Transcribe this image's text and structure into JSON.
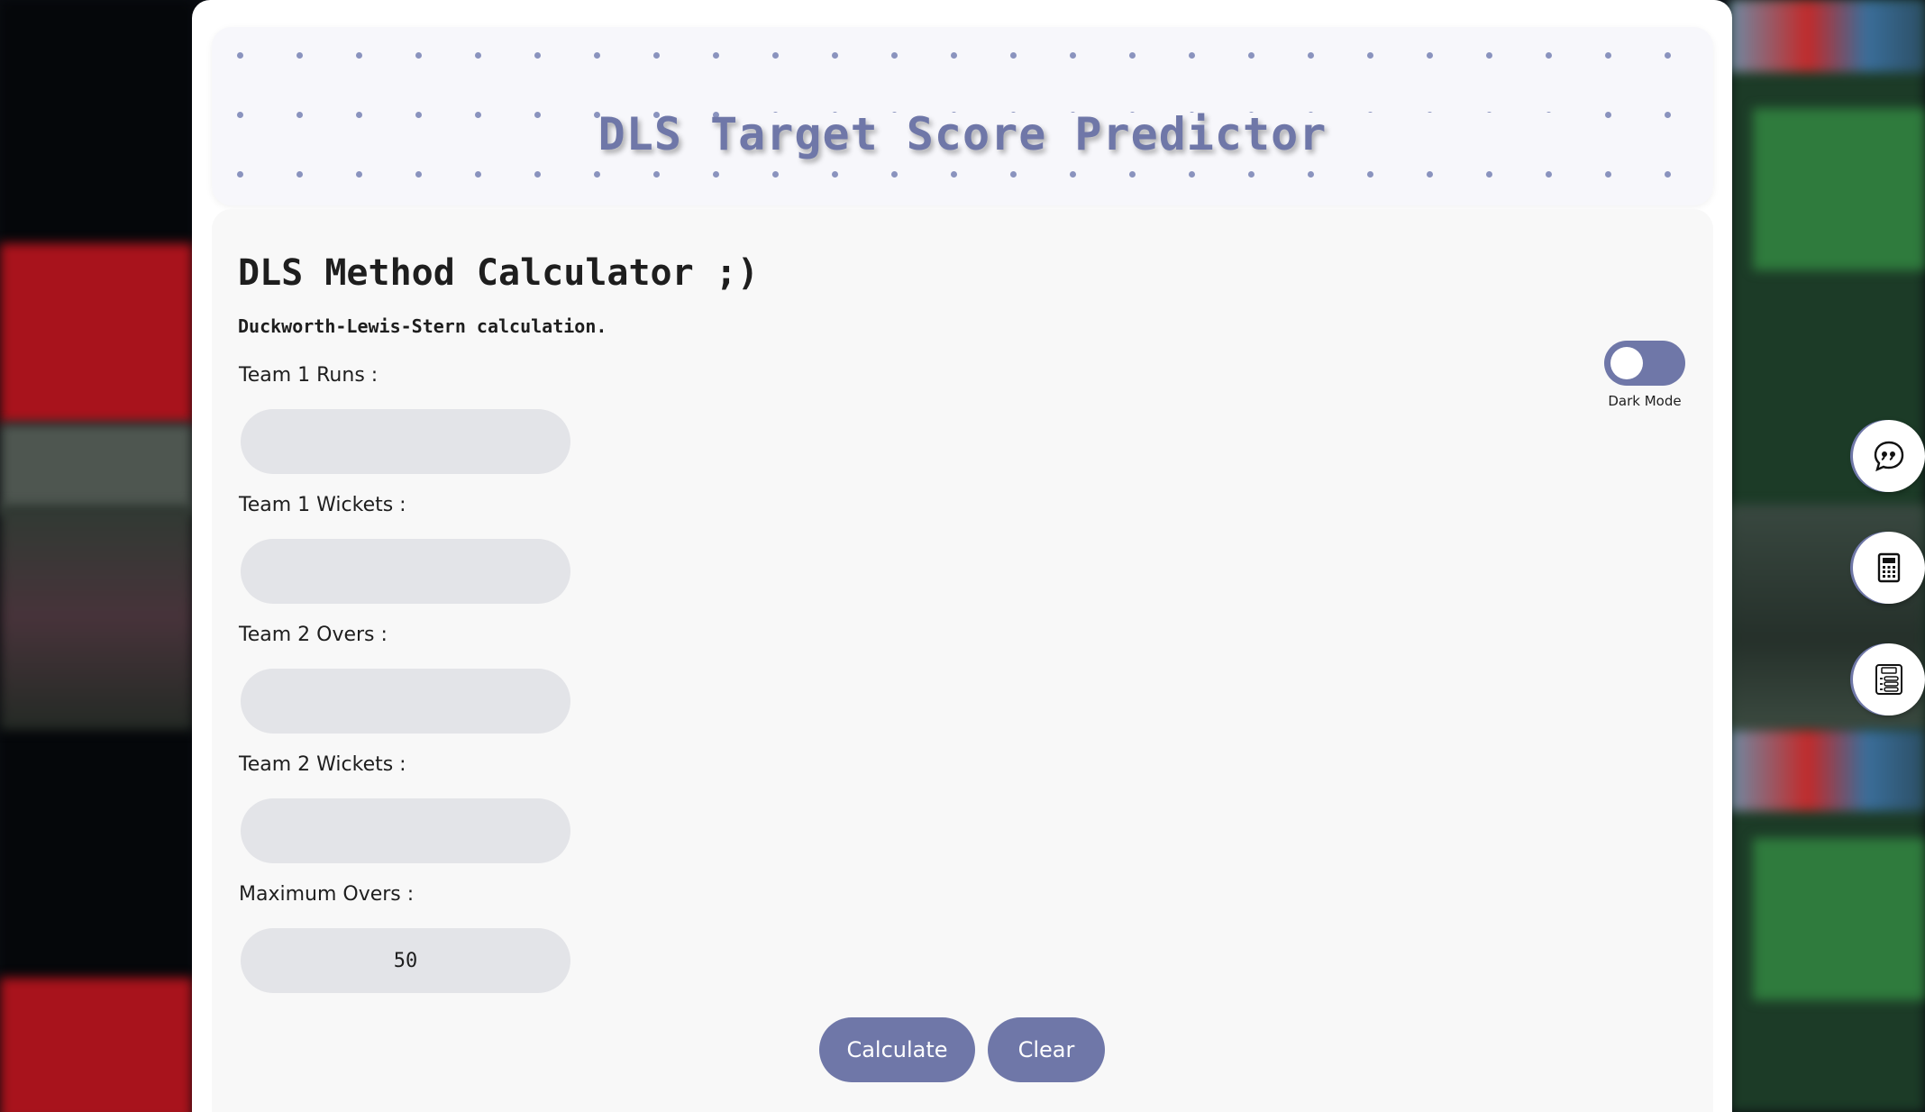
{
  "header": {
    "title": "DLS Target Score Predictor"
  },
  "calculator": {
    "title": "DLS Method Calculator ;)",
    "subtitle": "Duckworth-Lewis-Stern calculation.",
    "fields": [
      {
        "label": "Team 1 Runs :",
        "value": ""
      },
      {
        "label": "Team 1 Wickets :",
        "value": ""
      },
      {
        "label": "Team 2 Overs :",
        "value": ""
      },
      {
        "label": "Team 2 Wickets :",
        "value": ""
      },
      {
        "label": "Maximum Overs :",
        "value": "50"
      }
    ],
    "calculate_label": "Calculate",
    "clear_label": "Clear"
  },
  "dark_mode": {
    "label": "Dark Mode",
    "enabled": false
  },
  "side_buttons": [
    {
      "icon": "quote-chat-icon"
    },
    {
      "icon": "calculator-icon"
    },
    {
      "icon": "plan-list-icon"
    }
  ],
  "colors": {
    "accent": "#6f77a8",
    "input_bg": "#e3e4e8",
    "panel_bg": "#f8f8f8"
  }
}
